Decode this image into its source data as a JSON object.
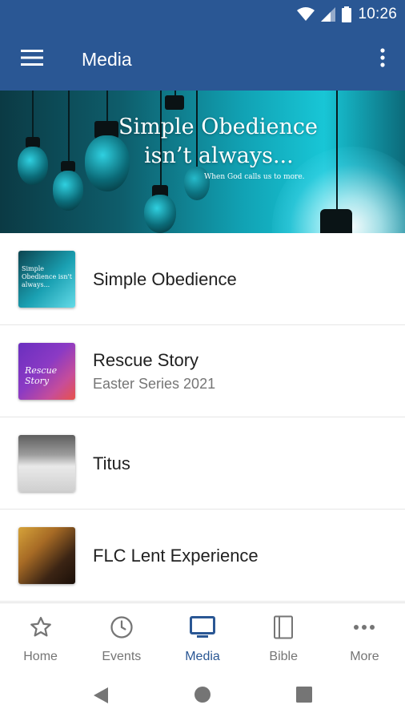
{
  "status_bar": {
    "time": "10:26",
    "icons": [
      "wifi-icon",
      "cell-signal-icon",
      "battery-icon"
    ]
  },
  "app_bar": {
    "title": "Media",
    "menu_icon": "hamburger-menu-icon",
    "overflow_icon": "more-vert-icon"
  },
  "banner": {
    "title_line1": "Simple Obedience",
    "title_line2": "isn’t always...",
    "subtitle": "When God calls us to more."
  },
  "media_items": [
    {
      "title": "Simple Obedience",
      "subtitle": "",
      "thumb_text": "Simple Obedience isn't always..."
    },
    {
      "title": "Rescue Story",
      "subtitle": "Easter Series 2021",
      "thumb_text": "Rescue Story"
    },
    {
      "title": "Titus",
      "subtitle": ""
    },
    {
      "title": "FLC Lent Experience",
      "subtitle": ""
    }
  ],
  "bottom_nav": {
    "items": [
      {
        "label": "Home",
        "icon": "star-icon",
        "active": false
      },
      {
        "label": "Events",
        "icon": "clock-icon",
        "active": false
      },
      {
        "label": "Media",
        "icon": "tv-icon",
        "active": true
      },
      {
        "label": "Bible",
        "icon": "book-icon",
        "active": false
      },
      {
        "label": "More",
        "icon": "more-horiz-icon",
        "active": false
      }
    ]
  },
  "colors": {
    "primary": "#2a5794",
    "inactive": "#757575",
    "text_primary": "#212121"
  }
}
